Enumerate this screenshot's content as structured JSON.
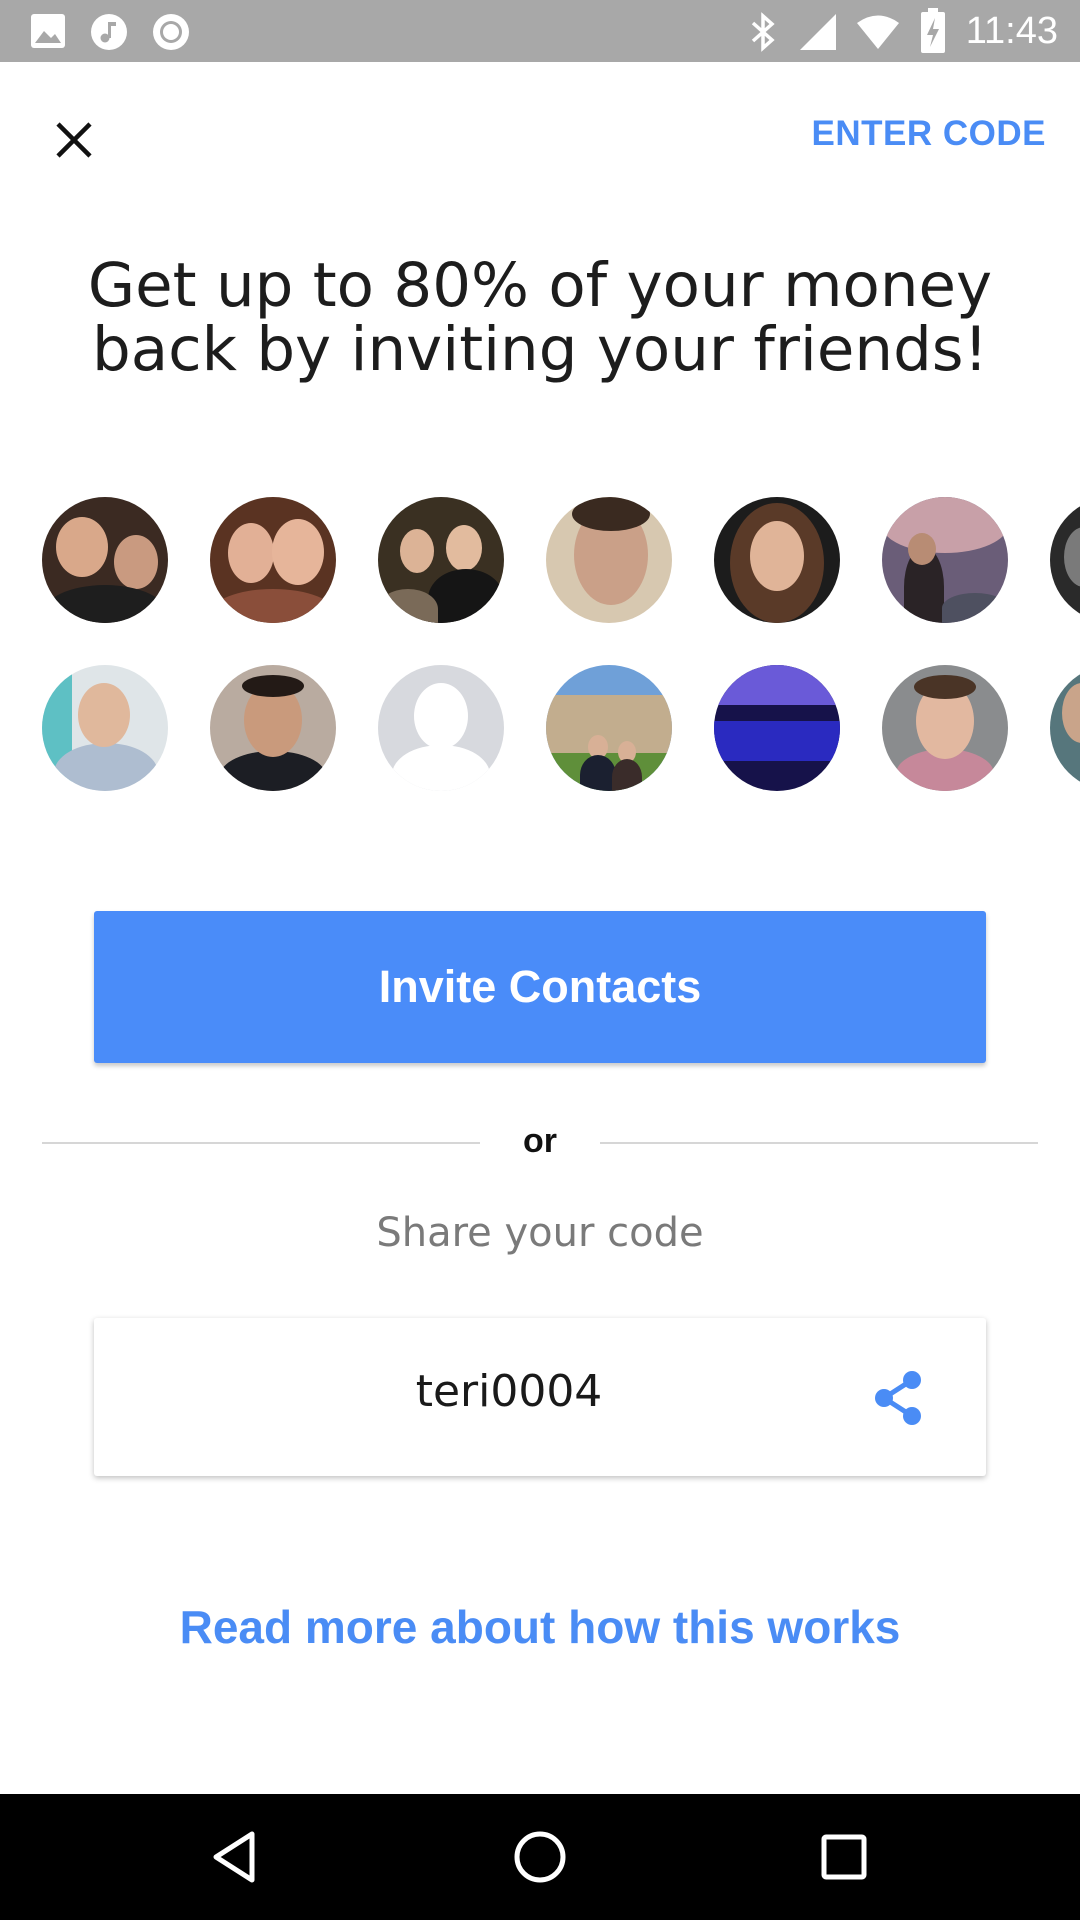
{
  "status_bar": {
    "time": "11:43",
    "left_icons": [
      "image-icon",
      "music-icon",
      "record-icon"
    ],
    "right_icons": [
      "bluetooth-icon",
      "cell-signal-icon",
      "wifi-icon",
      "battery-charging-icon"
    ]
  },
  "header": {
    "close_icon": "close-icon",
    "enter_code_label": "ENTER CODE"
  },
  "headline": {
    "line1": "Get up to 80% of your money",
    "line2": "back by inviting your friends!"
  },
  "avatars": {
    "row1_count_visible": 7,
    "row2_count_visible": 7
  },
  "invite_button": {
    "label": "Invite Contacts"
  },
  "divider": {
    "label": "or"
  },
  "share": {
    "label": "Share your code",
    "code": "teri0004",
    "share_icon": "share-icon"
  },
  "read_more": {
    "label": "Read more about how this works"
  },
  "nav_bar": {
    "buttons": [
      "back-icon",
      "home-icon",
      "recents-icon"
    ]
  },
  "colors": {
    "accent": "#4a8cf5",
    "status_bar": "#a8a8a8",
    "nav_bar": "#000000",
    "divider": "#d6d6d6"
  }
}
